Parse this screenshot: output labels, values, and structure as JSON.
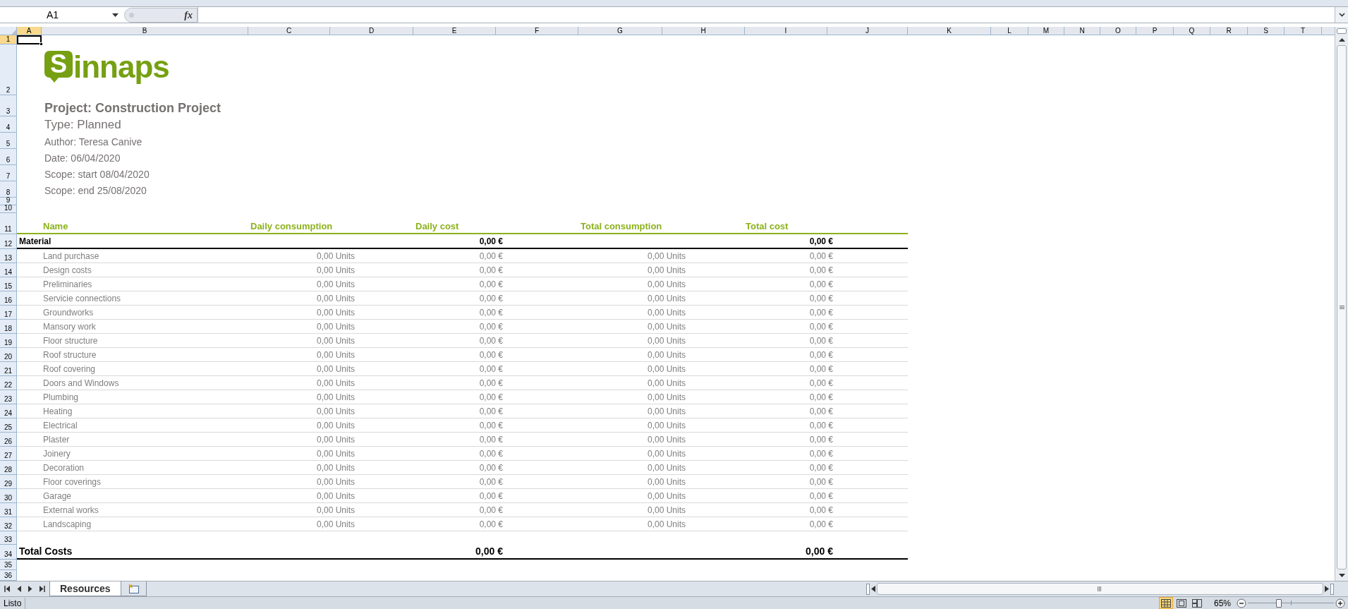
{
  "formula_bar": {
    "name_box": "A1",
    "function_label": "fx"
  },
  "columns": [
    {
      "label": "A",
      "selected": true
    },
    {
      "label": "B",
      "selected": false
    },
    {
      "label": "C",
      "selected": false
    },
    {
      "label": "D",
      "selected": false
    },
    {
      "label": "E",
      "selected": false
    },
    {
      "label": "F",
      "selected": false
    },
    {
      "label": "G",
      "selected": false
    },
    {
      "label": "H",
      "selected": false
    },
    {
      "label": "I",
      "selected": false
    },
    {
      "label": "J",
      "selected": false
    },
    {
      "label": "K",
      "selected": false
    },
    {
      "label": "L",
      "selected": false
    },
    {
      "label": "M",
      "selected": false
    },
    {
      "label": "N",
      "selected": false
    },
    {
      "label": "O",
      "selected": false
    },
    {
      "label": "P",
      "selected": false
    },
    {
      "label": "Q",
      "selected": false
    },
    {
      "label": "R",
      "selected": false
    },
    {
      "label": "S",
      "selected": false
    },
    {
      "label": "T",
      "selected": false
    }
  ],
  "row_headers": [
    {
      "label": "1",
      "selected": true
    },
    {
      "label": "2",
      "selected": false
    },
    {
      "label": "3",
      "selected": false
    },
    {
      "label": "4",
      "selected": false
    },
    {
      "label": "5",
      "selected": false
    },
    {
      "label": "6",
      "selected": false
    },
    {
      "label": "7",
      "selected": false
    },
    {
      "label": "8",
      "selected": false
    },
    {
      "label": "9",
      "selected": false
    },
    {
      "label": "10",
      "selected": false
    },
    {
      "label": "11",
      "selected": false
    },
    {
      "label": "12",
      "selected": false
    },
    {
      "label": "13",
      "selected": false
    },
    {
      "label": "14",
      "selected": false
    },
    {
      "label": "15",
      "selected": false
    },
    {
      "label": "16",
      "selected": false
    },
    {
      "label": "17",
      "selected": false
    },
    {
      "label": "18",
      "selected": false
    },
    {
      "label": "19",
      "selected": false
    },
    {
      "label": "20",
      "selected": false
    },
    {
      "label": "21",
      "selected": false
    },
    {
      "label": "22",
      "selected": false
    },
    {
      "label": "23",
      "selected": false
    },
    {
      "label": "24",
      "selected": false
    },
    {
      "label": "25",
      "selected": false
    },
    {
      "label": "26",
      "selected": false
    },
    {
      "label": "27",
      "selected": false
    },
    {
      "label": "28",
      "selected": false
    },
    {
      "label": "29",
      "selected": false
    },
    {
      "label": "30",
      "selected": false
    },
    {
      "label": "31",
      "selected": false
    },
    {
      "label": "32",
      "selected": false
    },
    {
      "label": "33",
      "selected": false
    },
    {
      "label": "34",
      "selected": false
    },
    {
      "label": "35",
      "selected": false
    },
    {
      "label": "36",
      "selected": false
    }
  ],
  "sheet": {
    "logo": {
      "badge_letter": "S",
      "rest": "innaps"
    },
    "title": "Project: Construction Project",
    "type": "Type: Planned",
    "meta": [
      "Author: Teresa Canive",
      "Date: 06/04/2020",
      "Scope: start 08/04/2020",
      "Scope: end 25/08/2020"
    ],
    "table": {
      "columns": [
        "Name",
        "Daily consumption",
        "Daily cost",
        "Total consumption",
        "Total cost"
      ],
      "group": {
        "name": "Material",
        "daily_cost": "0,00 €",
        "total_cost": "0,00 €"
      },
      "rows": [
        {
          "name": "Land purchase",
          "daily_consumption": "0,00 Units",
          "daily_cost": "0,00 €",
          "total_consumption": "0,00 Units",
          "total_cost": "0,00 €"
        },
        {
          "name": "Design costs",
          "daily_consumption": "0,00 Units",
          "daily_cost": "0,00 €",
          "total_consumption": "0,00 Units",
          "total_cost": "0,00 €"
        },
        {
          "name": "Preliminaries",
          "daily_consumption": "0,00 Units",
          "daily_cost": "0,00 €",
          "total_consumption": "0,00 Units",
          "total_cost": "0,00 €"
        },
        {
          "name": "Servicie connections",
          "daily_consumption": "0,00 Units",
          "daily_cost": "0,00 €",
          "total_consumption": "0,00 Units",
          "total_cost": "0,00 €"
        },
        {
          "name": "Groundworks",
          "daily_consumption": "0,00 Units",
          "daily_cost": "0,00 €",
          "total_consumption": "0,00 Units",
          "total_cost": "0,00 €"
        },
        {
          "name": "Mansory work",
          "daily_consumption": "0,00 Units",
          "daily_cost": "0,00 €",
          "total_consumption": "0,00 Units",
          "total_cost": "0,00 €"
        },
        {
          "name": "Floor structure",
          "daily_consumption": "0,00 Units",
          "daily_cost": "0,00 €",
          "total_consumption": "0,00 Units",
          "total_cost": "0,00 €"
        },
        {
          "name": "Roof structure",
          "daily_consumption": "0,00 Units",
          "daily_cost": "0,00 €",
          "total_consumption": "0,00 Units",
          "total_cost": "0,00 €"
        },
        {
          "name": "Roof covering",
          "daily_consumption": "0,00 Units",
          "daily_cost": "0,00 €",
          "total_consumption": "0,00 Units",
          "total_cost": "0,00 €"
        },
        {
          "name": "Doors and Windows",
          "daily_consumption": "0,00 Units",
          "daily_cost": "0,00 €",
          "total_consumption": "0,00 Units",
          "total_cost": "0,00 €"
        },
        {
          "name": "Plumbing",
          "daily_consumption": "0,00 Units",
          "daily_cost": "0,00 €",
          "total_consumption": "0,00 Units",
          "total_cost": "0,00 €"
        },
        {
          "name": "Heating",
          "daily_consumption": "0,00 Units",
          "daily_cost": "0,00 €",
          "total_consumption": "0,00 Units",
          "total_cost": "0,00 €"
        },
        {
          "name": "Electrical",
          "daily_consumption": "0,00 Units",
          "daily_cost": "0,00 €",
          "total_consumption": "0,00 Units",
          "total_cost": "0,00 €"
        },
        {
          "name": "Plaster",
          "daily_consumption": "0,00 Units",
          "daily_cost": "0,00 €",
          "total_consumption": "0,00 Units",
          "total_cost": "0,00 €"
        },
        {
          "name": "Joinery",
          "daily_consumption": "0,00 Units",
          "daily_cost": "0,00 €",
          "total_consumption": "0,00 Units",
          "total_cost": "0,00 €"
        },
        {
          "name": "Decoration",
          "daily_consumption": "0,00 Units",
          "daily_cost": "0,00 €",
          "total_consumption": "0,00 Units",
          "total_cost": "0,00 €"
        },
        {
          "name": "Floor coverings",
          "daily_consumption": "0,00 Units",
          "daily_cost": "0,00 €",
          "total_consumption": "0,00 Units",
          "total_cost": "0,00 €"
        },
        {
          "name": "Garage",
          "daily_consumption": "0,00 Units",
          "daily_cost": "0,00 €",
          "total_consumption": "0,00 Units",
          "total_cost": "0,00 €"
        },
        {
          "name": "External works",
          "daily_consumption": "0,00 Units",
          "daily_cost": "0,00 €",
          "total_consumption": "0,00 Units",
          "total_cost": "0,00 €"
        },
        {
          "name": "Landscaping",
          "daily_consumption": "0,00 Units",
          "daily_cost": "0,00 €",
          "total_consumption": "0,00 Units",
          "total_cost": "0,00 €"
        }
      ],
      "total": {
        "label": "Total Costs",
        "daily_cost": "0,00 €",
        "total_cost": "0,00 €"
      }
    }
  },
  "sheet_tabs": [
    {
      "label": "Resources",
      "selected": true
    }
  ],
  "status_bar": {
    "status": "Listo",
    "views": [
      {
        "kind": "normal",
        "selected": true
      },
      {
        "kind": "page_layout",
        "selected": false
      },
      {
        "kind": "page_break",
        "selected": false
      }
    ],
    "zoom": "65%",
    "zoom_slider": {
      "level": 0.36
    }
  }
}
